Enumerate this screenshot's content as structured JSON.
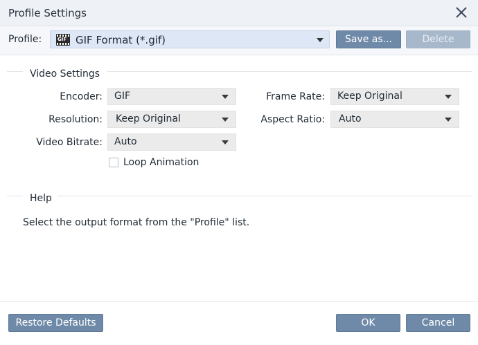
{
  "window": {
    "title": "Profile Settings",
    "close_icon": "close-icon"
  },
  "profile": {
    "label": "Profile:",
    "value": "GIF Format (*.gif)",
    "icon": "gif-icon",
    "icon_text": "GIF",
    "save_as_label": "Save as...",
    "delete_label": "Delete"
  },
  "video_settings": {
    "title": "Video Settings",
    "encoder": {
      "label": "Encoder:",
      "value": "GIF"
    },
    "resolution": {
      "label": "Resolution:",
      "value": "Keep Original"
    },
    "video_bitrate": {
      "label": "Video Bitrate:",
      "value": "Auto"
    },
    "frame_rate": {
      "label": "Frame Rate:",
      "value": "Keep Original"
    },
    "aspect_ratio": {
      "label": "Aspect Ratio:",
      "value": "Auto"
    },
    "loop_animation": {
      "label": "Loop Animation",
      "checked": false
    }
  },
  "help": {
    "title": "Help",
    "text": "Select the output format from the \"Profile\" list."
  },
  "footer": {
    "restore_label": "Restore Defaults",
    "ok_label": "OK",
    "cancel_label": "Cancel"
  },
  "colors": {
    "button": "#6f8aa8",
    "button_disabled": "#a8b8cb",
    "profile_select_bg": "#dde7f5",
    "titlebar_bg": "#eef1f6"
  }
}
